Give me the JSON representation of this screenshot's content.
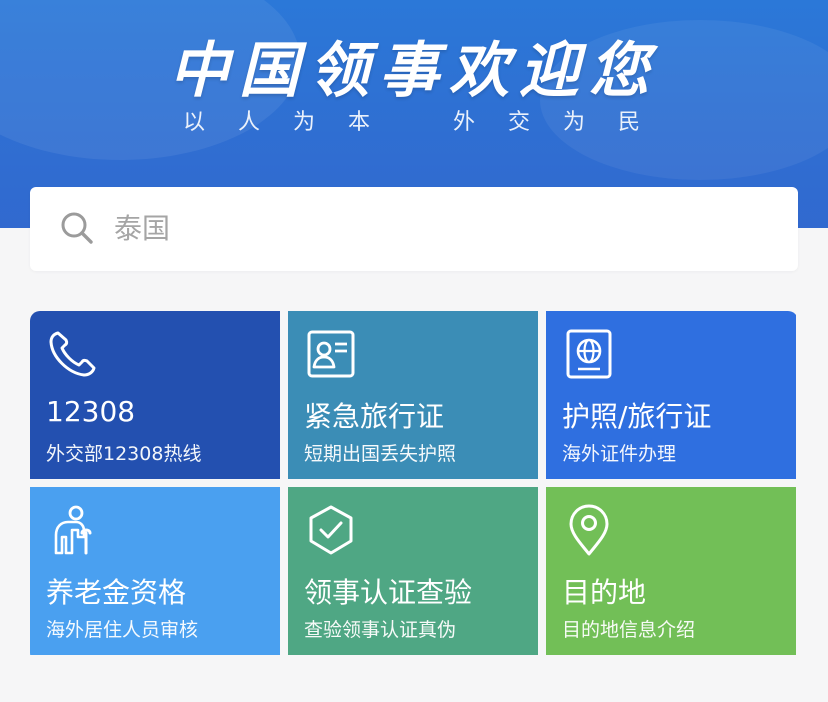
{
  "header": {
    "title": "中国领事欢迎您",
    "slogan_left": "以人为本",
    "slogan_right": "外交为民"
  },
  "search": {
    "value": "泰国",
    "icon": "search-icon"
  },
  "tiles": [
    {
      "title": "12308",
      "subtitle": "外交部12308热线",
      "icon": "phone-icon",
      "color": "#2350b0"
    },
    {
      "title": "紧急旅行证",
      "subtitle": "短期出国丢失护照",
      "icon": "id-card-icon",
      "color": "#3b8db6"
    },
    {
      "title": "护照/旅行证",
      "subtitle": "海外证件办理",
      "icon": "passport-icon",
      "color": "#2f6fe0"
    },
    {
      "title": "养老金资格",
      "subtitle": "海外居住人员审核",
      "icon": "elderly-icon",
      "color": "#4aa0f0"
    },
    {
      "title": "领事认证查验",
      "subtitle": "查验领事认证真伪",
      "icon": "shield-check-icon",
      "color": "#4fa784"
    },
    {
      "title": "目的地",
      "subtitle": "目的地信息介绍",
      "icon": "location-pin-icon",
      "color": "#72bf57"
    }
  ]
}
